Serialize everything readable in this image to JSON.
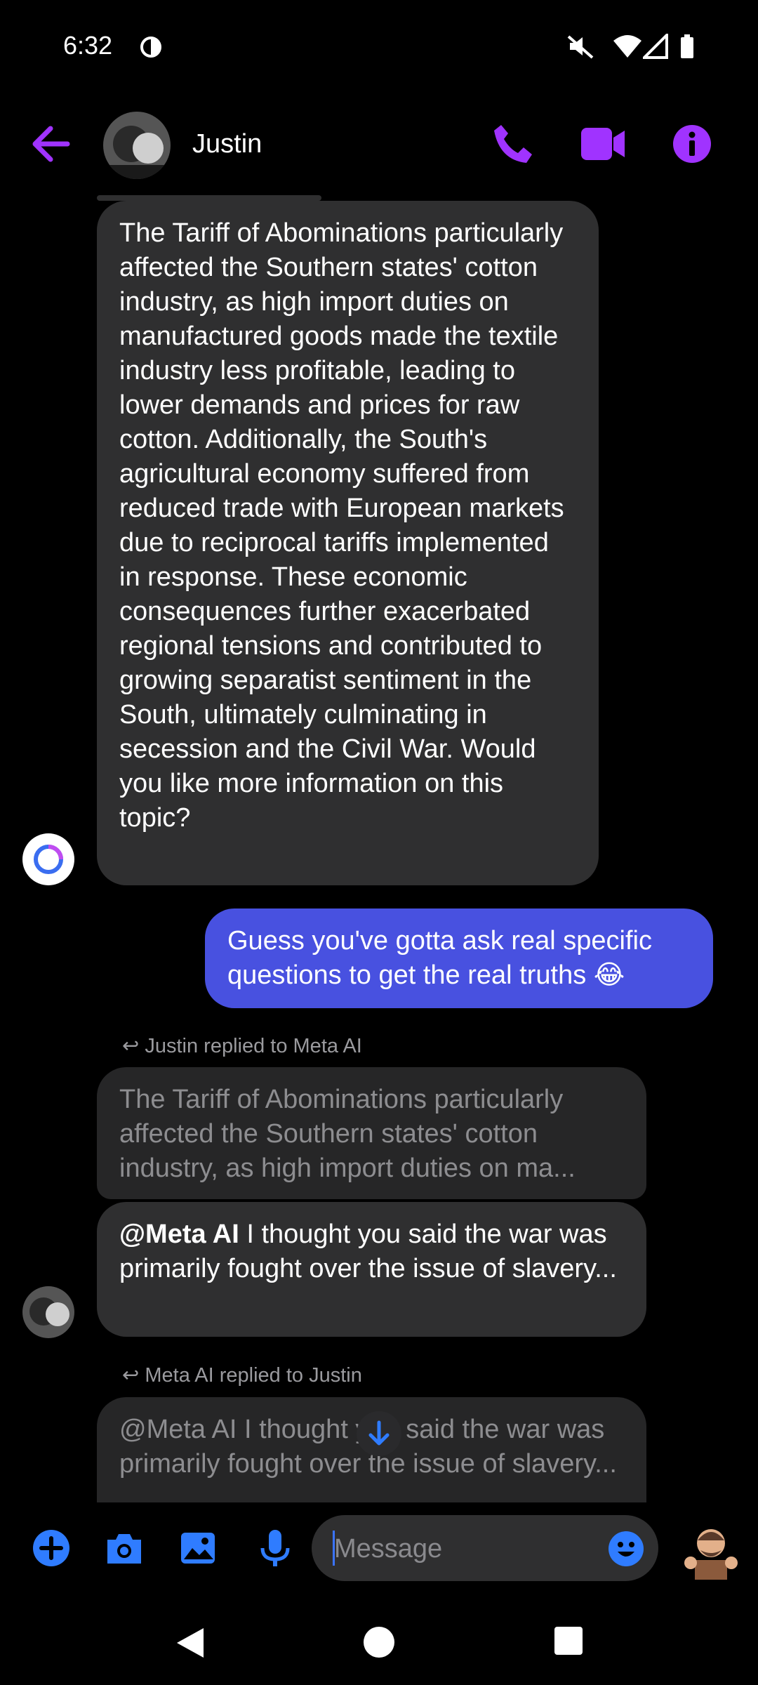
{
  "status_bar": {
    "time": "6:32"
  },
  "header": {
    "contact_name": "Justin"
  },
  "messages": {
    "ai_message_1": "The Tariff of Abominations particularly affected the Southern states' cotton industry, as high import duties on manufactured goods made the textile industry less profitable, leading to lower demands and prices for raw cotton. Additionally, the South's agricultural economy suffered from reduced trade with European markets due to reciprocal tariffs implemented in response. These economic consequences further exacerbated regional tensions and contributed to growing separatist sentiment in the South, ultimately culminating in secession and the Civil War. Would you like more information on this topic?",
    "outgoing_1": "Guess you've gotta ask real specific questions to get the real truths 😂",
    "reply_label_1": "Justin replied to Meta AI",
    "quoted_1": "The Tariff of Abominations particularly affected the Southern states' cotton industry, as high import duties on ma...",
    "justin_mention": "@Meta AI",
    "justin_text": " I thought you said the war was primarily fought over the issue of slavery...",
    "reply_label_2": "Meta AI replied to Justin",
    "quoted_2": "@Meta AI I thought you said the war was primarily fought over the issue of slavery..."
  },
  "composer": {
    "placeholder": "Message"
  },
  "colors": {
    "accent_purple": "#a033ff",
    "bubble_out": "#4851e0",
    "bubble_in": "#2f2f30",
    "composer_blue": "#2f7cff"
  }
}
